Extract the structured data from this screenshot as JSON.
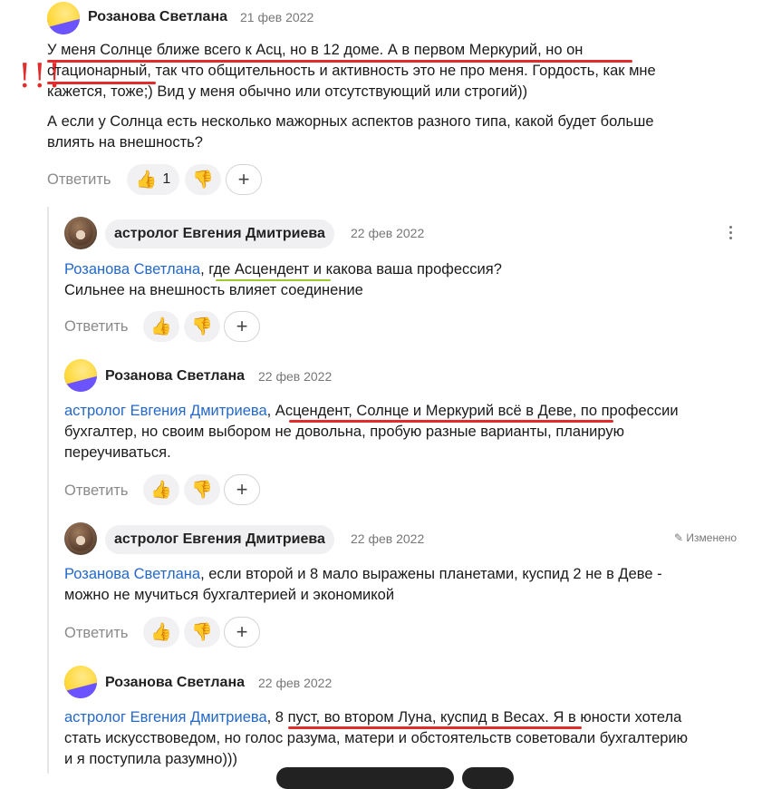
{
  "annotation_marks": "!!!",
  "comments": [
    {
      "author": "Розанова Светлана",
      "date": "21 фев 2022",
      "lines": [
        "У меня Солнце ближе всего к Асц, но в 12 доме. А в первом Меркурий, но он",
        "стационарный, так что общительность и активность это не про меня. Гордость, как мне",
        "кажется, тоже;) Вид у меня обычно или отсутствующий или строгий))"
      ],
      "lines2": [
        "А если у Солнца есть несколько мажорных аспектов разного типа, какой будет больше",
        "влиять на внешность?"
      ],
      "reply_label": "Ответить",
      "like_count": "1"
    },
    {
      "author": "астролог Евгения Дмитриева",
      "date": "22 фев 2022",
      "mention": "Розанова Светлана",
      "rest_line1": ", где Асцендент и какова ваша профессия?",
      "line2": "Сильнее на внешность влияет соединение",
      "reply_label": "Ответить"
    },
    {
      "author": "Розанова Светлана",
      "date": "22 фев 2022",
      "mention": "астролог Евгения Дмитриева",
      "rest_line1": ", Асцендент, Солнце и Меркурий всё в Деве, по профессии",
      "line2": "бухгалтер, но своим выбором не довольна, пробую разные варианты, планирую",
      "line3": "переучиваться.",
      "reply_label": "Ответить"
    },
    {
      "author": "астролог Евгения Дмитриева",
      "date": "22 фев 2022",
      "edited": "Изменено",
      "mention": "Розанова Светлана",
      "rest_line1": ", если второй и 8 мало выражены планетами, куспид 2 не в Деве -",
      "line2": "можно не мучиться бухгалтерией и экономикой",
      "reply_label": "Ответить"
    },
    {
      "author": "Розанова Светлана",
      "date": "22 фев 2022",
      "mention": "астролог Евгения Дмитриева",
      "rest_line1": ", 8 пуст, во втором Луна, куспид в Весах. Я в юности хотела",
      "line2": "стать искусствоведом, но голос разума, матери и обстоятельств советовали бухгалтерию",
      "line3": "и я поступила разумно)))"
    }
  ],
  "colors": {
    "link": "#2468c8",
    "underline_red": "#e22b2b",
    "underline_green": "#9cc92d"
  },
  "icons": [
    "thumbs-up-icon",
    "thumbs-down-icon",
    "plus-icon",
    "more-vertical-icon",
    "pencil-icon"
  ]
}
